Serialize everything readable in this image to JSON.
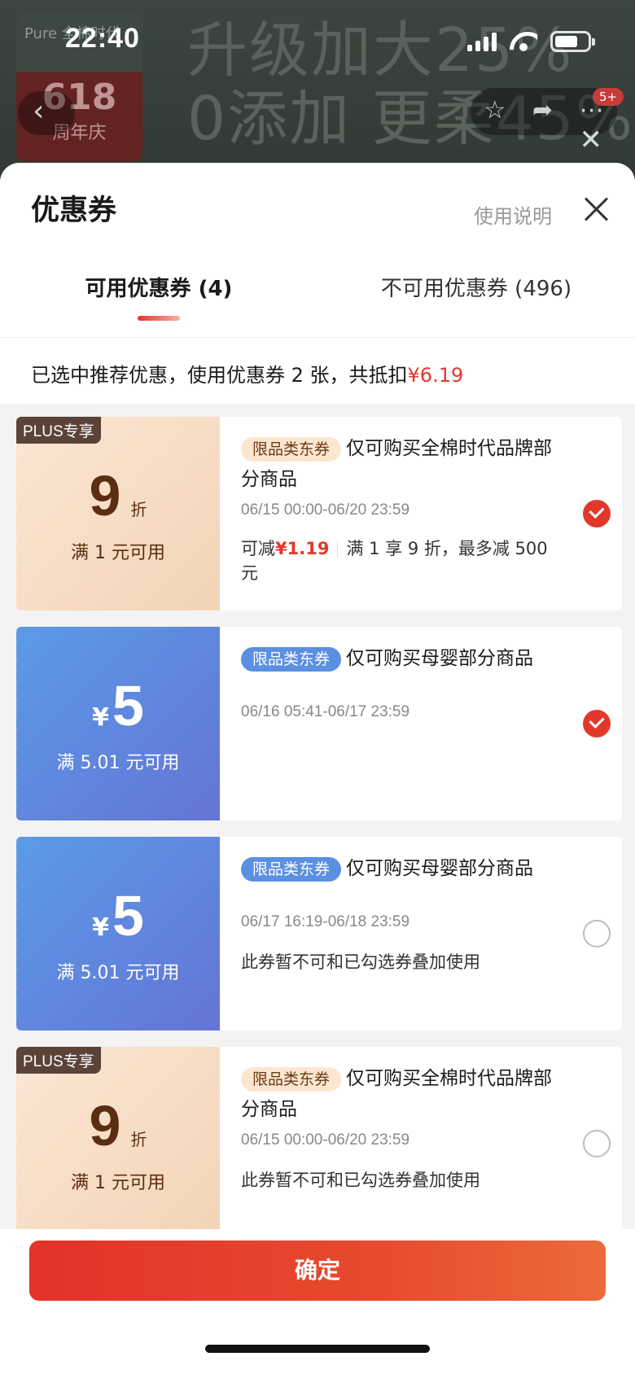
{
  "status_bar": {
    "time": "22:40",
    "battery_level": 0.7
  },
  "background": {
    "banner_line1": "升级加大25%",
    "banner_line2": "0添加 更柔45%",
    "brand_top": "Pure 全棉时代",
    "brand_618": "618",
    "brand_sub": "周年庆",
    "badge": "5+"
  },
  "sheet": {
    "title": "优惠券",
    "help_link": "使用说明",
    "tabs": [
      {
        "label": "可用优惠券 (4)"
      },
      {
        "label": "不可用优惠券 (496)"
      }
    ],
    "summary_text": "已选中推荐优惠，使用优惠券 2 张，共抵扣",
    "summary_amount": "¥6.19"
  },
  "coupons": [
    {
      "plus_tag": "PLUS专享",
      "value": "9",
      "unit": "折",
      "condition": "满 1 元可用",
      "category_tag": "限品类东券",
      "title": "仅可购买全棉时代品牌部分商品",
      "date": "06/15 00:00-06/20 23:59",
      "save_prefix": "可减",
      "save_amount": "¥1.19",
      "save_rule": "满 1 享 9 折，最多减 500 元",
      "checked": true
    },
    {
      "currency": "¥",
      "value": "5",
      "condition": "满 5.01 元可用",
      "category_tag": "限品类东券",
      "title": "仅可购买母婴部分商品",
      "date": "06/16 05:41-06/17 23:59",
      "checked": true
    },
    {
      "currency": "¥",
      "value": "5",
      "condition": "满 5.01 元可用",
      "category_tag": "限品类东券",
      "title": "仅可购买母婴部分商品",
      "date": "06/17 16:19-06/18 23:59",
      "note": "此券暂不可和已勾选券叠加使用",
      "checked": false
    },
    {
      "plus_tag": "PLUS专享",
      "value": "9",
      "unit": "折",
      "condition": "满 1 元可用",
      "category_tag": "限品类东券",
      "title": "仅可购买全棉时代品牌部分商品",
      "date": "06/15 00:00-06/20 23:59",
      "note": "此券暂不可和已勾选券叠加使用",
      "checked": false
    }
  ],
  "footer": {
    "confirm_label": "确定"
  },
  "colors": {
    "accent": "#e2382b",
    "plus_bg": "#f3d3b6",
    "blue_bg": "#6474d6"
  }
}
